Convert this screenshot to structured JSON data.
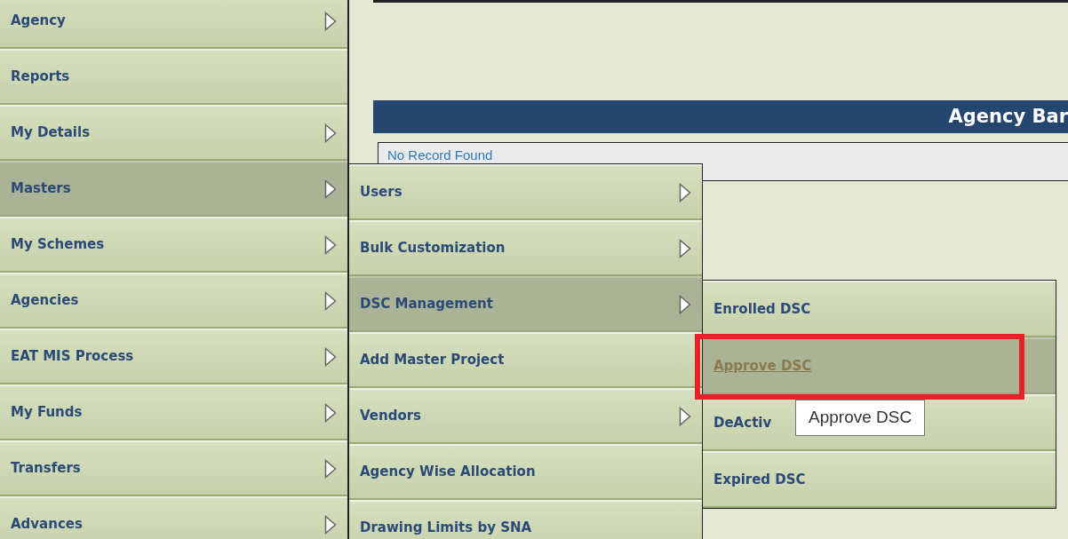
{
  "main_menu": [
    {
      "label": "Agency",
      "has_submenu": true,
      "highlighted": false
    },
    {
      "label": "Reports",
      "has_submenu": false,
      "highlighted": false
    },
    {
      "label": "My Details",
      "has_submenu": true,
      "highlighted": false
    },
    {
      "label": "Masters",
      "has_submenu": true,
      "highlighted": true
    },
    {
      "label": "My Schemes",
      "has_submenu": true,
      "highlighted": false
    },
    {
      "label": "Agencies",
      "has_submenu": true,
      "highlighted": false
    },
    {
      "label": "EAT MIS Process",
      "has_submenu": true,
      "highlighted": false
    },
    {
      "label": "My Funds",
      "has_submenu": true,
      "highlighted": false
    },
    {
      "label": "Transfers",
      "has_submenu": true,
      "highlighted": false
    },
    {
      "label": "Advances",
      "has_submenu": true,
      "highlighted": false
    }
  ],
  "content": {
    "header": "Agency Bar",
    "empty_message": "No Record Found"
  },
  "masters_submenu": [
    {
      "label": "Users",
      "has_submenu": true,
      "highlighted": false
    },
    {
      "label": "Bulk Customization",
      "has_submenu": true,
      "highlighted": false
    },
    {
      "label": "DSC Management",
      "has_submenu": true,
      "highlighted": true
    },
    {
      "label": "Add Master Project",
      "has_submenu": false,
      "highlighted": false
    },
    {
      "label": "Vendors",
      "has_submenu": true,
      "highlighted": false
    },
    {
      "label": "Agency Wise Allocation",
      "has_submenu": false,
      "highlighted": false
    },
    {
      "label": "Drawing Limits by SNA",
      "has_submenu": false,
      "highlighted": false
    }
  ],
  "dsc_submenu": [
    {
      "label": "Enrolled DSC",
      "highlighted": false,
      "annotated": false
    },
    {
      "label": "Approve DSC",
      "highlighted": true,
      "annotated": true
    },
    {
      "label": "DeActiv",
      "highlighted": false,
      "annotated": false
    },
    {
      "label": "Expired DSC",
      "highlighted": false,
      "annotated": false
    }
  ],
  "tooltip": {
    "text": "Approve DSC"
  }
}
